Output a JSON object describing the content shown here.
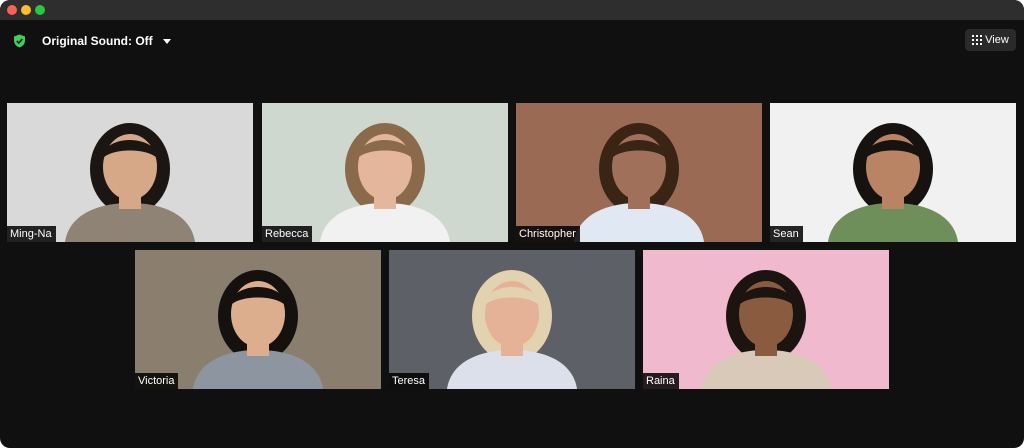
{
  "toolbar": {
    "original_sound_label": "Original Sound: Off",
    "view_label": "View",
    "shield_color": "#3ecf5a"
  },
  "participants": [
    {
      "name": "Ming-Na",
      "bg": "#d9d9d9",
      "skin": "#d7a888",
      "hair": "#1c1612",
      "shirt": "#8e8374"
    },
    {
      "name": "Rebecca",
      "bg": "#cfd8cf",
      "skin": "#e4b79c",
      "hair": "#8a6a4a",
      "shirt": "#f1f1f1"
    },
    {
      "name": "Christopher",
      "bg": "#9b6a55",
      "skin": "#a0705a",
      "hair": "#3a2414",
      "shirt": "#dfe8f3"
    },
    {
      "name": "Sean",
      "bg": "#f1f1f1",
      "skin": "#b98463",
      "hair": "#161210",
      "shirt": "#6f8f5a"
    },
    {
      "name": "Victoria",
      "bg": "#8a7f6e",
      "skin": "#dcae8e",
      "hair": "#14110f",
      "shirt": "#8c95a0"
    },
    {
      "name": "Teresa",
      "bg": "#5d6167",
      "skin": "#e5b197",
      "hair": "#e3d2b0",
      "shirt": "#dbe0ea"
    },
    {
      "name": "Raina",
      "bg": "#f1b9cd",
      "skin": "#8b5b40",
      "hair": "#1b1410",
      "shirt": "#d8c9b8"
    }
  ]
}
